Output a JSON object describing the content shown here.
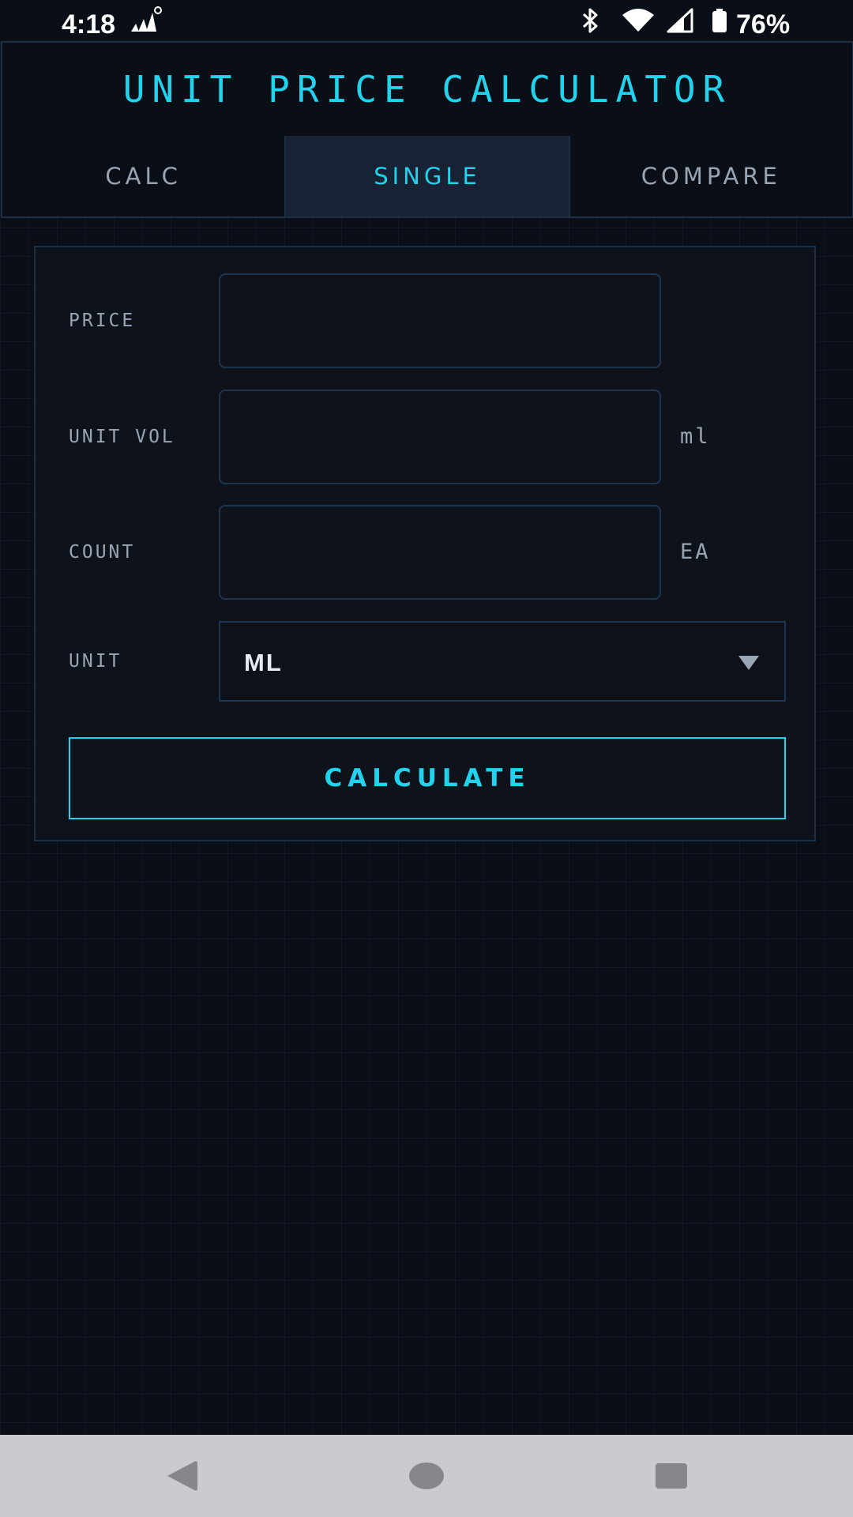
{
  "status_bar": {
    "time": "4:18",
    "battery_percent": "76%",
    "icons": [
      "signal-activity-icon",
      "bluetooth-icon",
      "wifi-icon",
      "cell-signal-icon",
      "battery-icon"
    ]
  },
  "header": {
    "title": "UNIT PRICE CALCULATOR"
  },
  "tabs": [
    {
      "label": "CALC",
      "active": false
    },
    {
      "label": "SINGLE",
      "active": true
    },
    {
      "label": "COMPARE",
      "active": false
    }
  ],
  "form": {
    "price": {
      "label": "PRICE",
      "value": "",
      "unit": ""
    },
    "unit_vol": {
      "label": "UNIT VOL",
      "value": "",
      "unit": "ml"
    },
    "count": {
      "label": "COUNT",
      "value": "",
      "unit": "EA"
    },
    "unit": {
      "label": "UNIT",
      "selected": "ML"
    },
    "calculate_label": "CALCULATE"
  },
  "nav_bar": {
    "icons": [
      "back-icon",
      "home-icon",
      "recents-icon"
    ]
  },
  "colors": {
    "background": "#0a0e16",
    "accent": "#22d3ee",
    "border": "#1e2e45",
    "tab_active_bg": "#172235",
    "muted_text": "#9aa5b4"
  }
}
